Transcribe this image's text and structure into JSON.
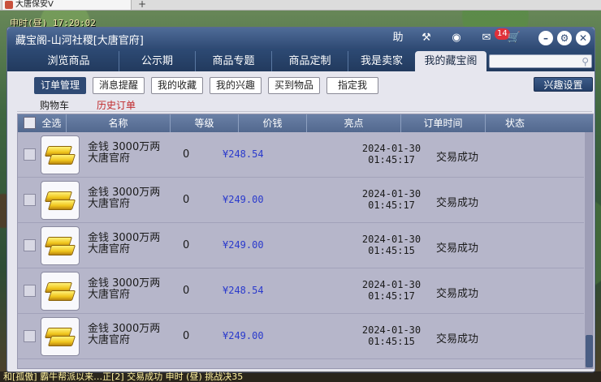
{
  "browser": {
    "tab_title": "大唐保安V",
    "new_tab": "+"
  },
  "game": {
    "time": "申时(昼)  17:20:02",
    "chat": "和[孤傲] 霸牛帮派以来…正[2]   交易成功 申时 (昼) 挑战决35"
  },
  "window": {
    "title": "藏宝阁-山河社稷[大唐官府]",
    "help": "助",
    "message_count": "14"
  },
  "nav": {
    "tabs": [
      "浏览商品",
      "公示期",
      "商品专题",
      "商品定制",
      "我是卖家",
      "我的藏宝阁"
    ],
    "active_index": 5,
    "search_placeholder": ""
  },
  "subtabs": {
    "items": [
      "订单管理",
      "消息提醒",
      "我的收藏",
      "我的兴趣",
      "买到物品",
      "指定我"
    ],
    "active_index": 0,
    "interest_settings": "兴趣设置"
  },
  "links": {
    "cart": "购物车",
    "history": "历史订单"
  },
  "table": {
    "headers": [
      "全选",
      "名称",
      "等级",
      "价钱",
      "亮点",
      "订单时间",
      "状态"
    ],
    "rows": [
      {
        "name1": "金钱 3000万两",
        "name2": "大唐官府",
        "level": "0",
        "price": "¥248.54",
        "date": "2024-01-30",
        "time": "01:45:17",
        "status": "交易成功"
      },
      {
        "name1": "金钱 3000万两",
        "name2": "大唐官府",
        "level": "0",
        "price": "¥249.00",
        "date": "2024-01-30",
        "time": "01:45:17",
        "status": "交易成功"
      },
      {
        "name1": "金钱 3000万两",
        "name2": "大唐官府",
        "level": "0",
        "price": "¥249.00",
        "date": "2024-01-30",
        "time": "01:45:15",
        "status": "交易成功"
      },
      {
        "name1": "金钱 3000万两",
        "name2": "大唐官府",
        "level": "0",
        "price": "¥248.54",
        "date": "2024-01-30",
        "time": "01:45:17",
        "status": "交易成功"
      },
      {
        "name1": "金钱 3000万两",
        "name2": "大唐官府",
        "level": "0",
        "price": "¥249.00",
        "date": "2024-01-30",
        "time": "01:45:15",
        "status": "交易成功"
      }
    ]
  },
  "colors": {
    "title_bar": "#2f4a74",
    "price": "#2a3acc",
    "history_link": "#c0282a",
    "badge": "#e0303a"
  }
}
